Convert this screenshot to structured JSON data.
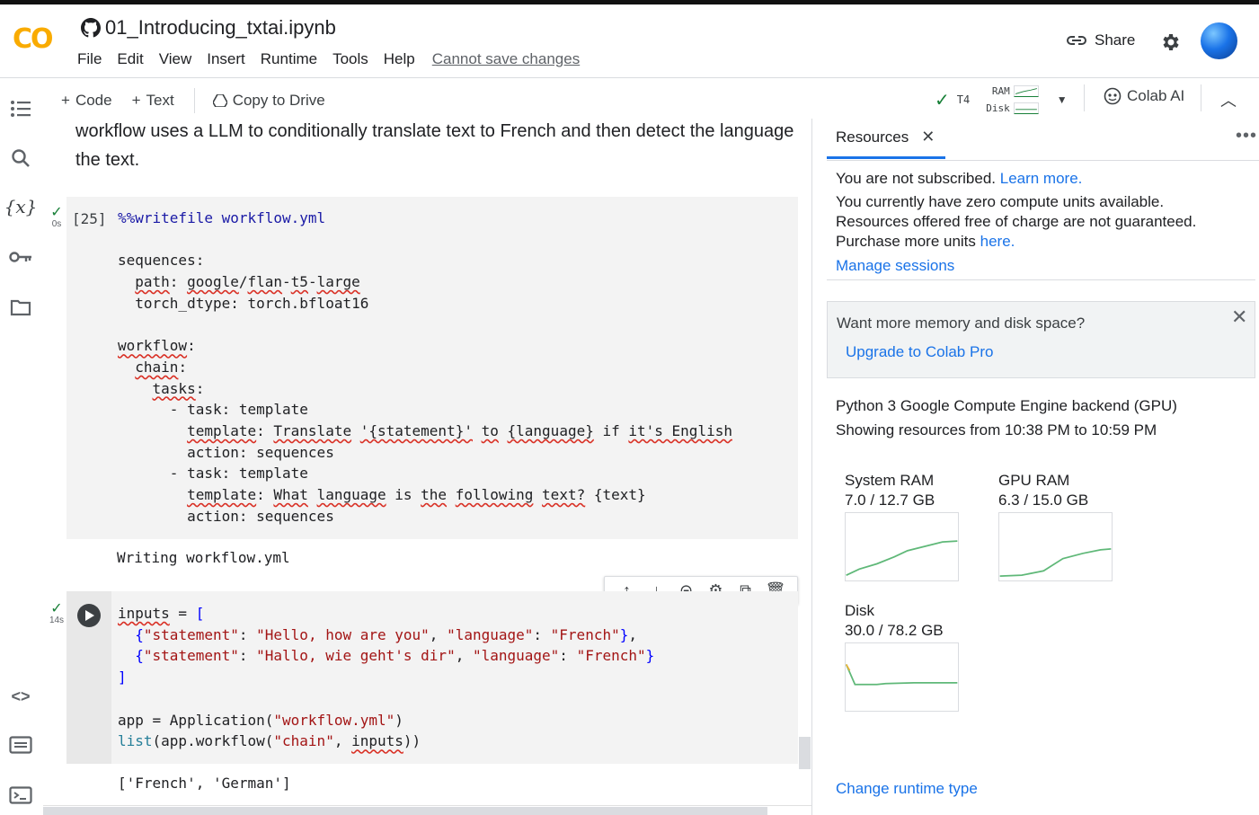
{
  "app": {
    "logo": "CO",
    "notebook_title": "01_Introducing_txtai.ipynb",
    "menu": [
      "File",
      "Edit",
      "View",
      "Insert",
      "Runtime",
      "Tools",
      "Help"
    ],
    "save_warning": "Cannot save changes",
    "share_label": "Share"
  },
  "toolbar": {
    "code_label": "Code",
    "text_label": "Text",
    "copy_label": "Copy to Drive",
    "runtime_gpu": "T4",
    "ram_label": "RAM",
    "disk_label": "Disk",
    "colab_ai_label": "Colab AI"
  },
  "notebook": {
    "intro_text": "workflow uses a LLM to conditionally translate text to French and then detect the language the text.",
    "cell1": {
      "exec_count": "[25]",
      "status_time": "0s",
      "code_lines": [
        "%%writefile workflow.yml",
        "",
        "sequences:",
        "  path: google/flan-t5-large",
        "  torch_dtype: torch.bfloat16",
        "",
        "workflow:",
        "  chain:",
        "    tasks:",
        "      - task: template",
        "        template: Translate '{statement}' to {language} if it's English",
        "        action: sequences",
        "      - task: template",
        "        template: What language is the following text? {text}",
        "        action: sequences"
      ],
      "output": "Writing workflow.yml"
    },
    "cell2": {
      "status_time": "14s",
      "code_lines": [
        "inputs = [",
        "  {\"statement\": \"Hello, how are you\", \"language\": \"French\"},",
        "  {\"statement\": \"Hallo, wie geht's dir\", \"language\": \"French\"}",
        "]",
        "",
        "app = Application(\"workflow.yml\")",
        "list(app.workflow(\"chain\", inputs))"
      ],
      "output": "['French', 'German']"
    }
  },
  "resources": {
    "tab_label": "Resources",
    "not_subscribed": "You are not subscribed.",
    "learn_more": "Learn more.",
    "compute_units": "You currently have zero compute units available.",
    "free_note": "Resources offered free of charge are not guaranteed.",
    "purchase_text": "Purchase more units",
    "purchase_link": "here.",
    "manage_sessions": "Manage sessions",
    "promo_title": "Want more memory and disk space?",
    "promo_link": "Upgrade to Colab Pro",
    "backend": "Python 3 Google Compute Engine backend (GPU)",
    "time_range": "Showing resources from 10:38 PM to 10:59 PM",
    "gauges": [
      {
        "title": "System RAM",
        "value": "7.0 / 12.7 GB",
        "used": 7.0,
        "total": 12.7
      },
      {
        "title": "GPU RAM",
        "value": "6.3 / 15.0 GB",
        "used": 6.3,
        "total": 15.0
      },
      {
        "title": "Disk",
        "value": "30.0 / 78.2 GB",
        "used": 30.0,
        "total": 78.2
      }
    ],
    "change_runtime": "Change runtime type"
  },
  "colors": {
    "accent": "#1a73e8",
    "success": "#188038",
    "chart_line": "#5fb878"
  }
}
